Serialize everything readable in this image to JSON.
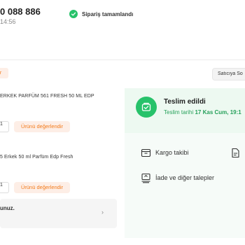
{
  "order": {
    "number": "0 088 886",
    "time": "14:56",
    "status": "Sipariş tamamlandı"
  },
  "seller": {
    "tag": "or",
    "button_label": "Satıcıya So"
  },
  "products": [
    {
      "name": "ERKEK PARFÜM 561 FRESH 50 ML EDP",
      "qty": "1",
      "rate_label": "Ürünü değerlendir"
    },
    {
      "name": "5 Erkek 50 ml Parfüm Edp Fresh",
      "qty": "1",
      "rate_label": "Ürünü değerlendir"
    }
  ],
  "notice": {
    "text": "unuz.",
    "arrow": "›"
  },
  "delivery": {
    "title": "Teslim edildi",
    "date_prefix": "Teslim tarihi",
    "date_value": "17 Kas Cum, 19:1"
  },
  "actions": {
    "cargo_label": "Kargo takibi",
    "returns_label": "İade ve diğer talepler"
  },
  "icons": {
    "status": "check-circle-icon",
    "delivery": "package-check-icon",
    "cargo": "truck-icon",
    "invoice": "document-icon",
    "returns": "return-box-icon"
  },
  "colors": {
    "accent_orange": "#f27a1a",
    "success_green": "#27c26a",
    "delivery_bg": "#edf9f1"
  }
}
